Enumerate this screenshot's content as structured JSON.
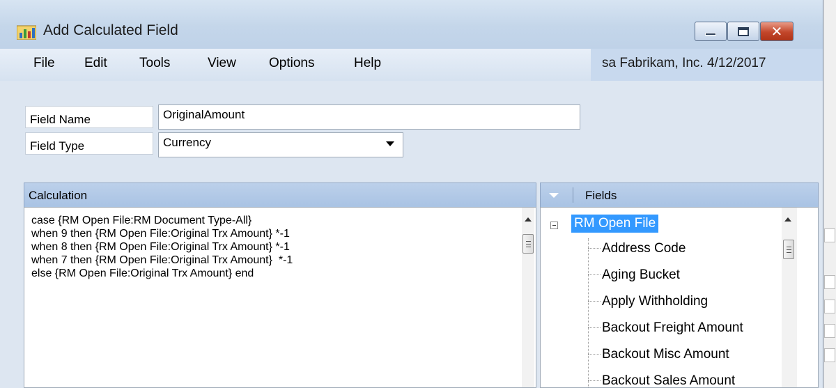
{
  "window": {
    "title": "Add Calculated Field"
  },
  "menu": {
    "file": "File",
    "edit": "Edit",
    "tools": "Tools",
    "view": "View",
    "options": "Options",
    "help": "Help"
  },
  "user_info": "sa  Fabrikam, Inc.  4/12/2017",
  "form": {
    "field_name_label": "Field Name",
    "field_name_value": "OriginalAmount",
    "field_type_label": "Field Type",
    "field_type_value": "Currency"
  },
  "calculation": {
    "header": "Calculation",
    "lines": [
      "case {RM Open File:RM Document Type-All}",
      "when 9 then {RM Open File:Original Trx Amount} *-1",
      "when 8 then {RM Open File:Original Trx Amount} *-1",
      "when 7 then {RM Open File:Original Trx Amount}  *-1",
      "else {RM Open File:Original Trx Amount} end"
    ]
  },
  "fields": {
    "header": "Fields",
    "root": "RM Open File",
    "items": [
      "Address Code",
      "Aging Bucket",
      "Apply Withholding",
      "Backout Freight Amount",
      "Backout Misc Amount",
      "Backout Sales Amount"
    ]
  },
  "icons": {
    "app": "app-chart-icon",
    "minimize": "minimize-icon",
    "maximize": "maximize-icon",
    "close": "close-icon"
  }
}
